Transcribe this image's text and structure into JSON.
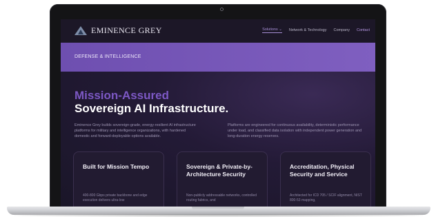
{
  "header": {
    "brand": "EMINENCE GREY",
    "nav": [
      "Solutions ⌄",
      "Network & Technology",
      "Company",
      "Contact"
    ]
  },
  "banner": {
    "label": "DEFENSE & INTELLIGENCE"
  },
  "hero": {
    "line1": "Mission-Assured",
    "line2": "Sovereign AI Infrastructure."
  },
  "intro": {
    "left": "Eminence Grey builds sovereign-grade, energy-resilient AI infrastructure platforms for military and intelligence organizations, with hardened domestic and forward-deployable options available.",
    "right": "Platforms are engineered for continuous availability, deterministic performance under load, and classified data isolation with independent power generation and long-duration energy reserves."
  },
  "cards": [
    {
      "title": "Built for Mission Tempo",
      "body": "400-800 Gbps private backbone and edge execution delivers ultra-low"
    },
    {
      "title": "Sovereign & Private-by-Architecture Security",
      "body": "Non-publicly addressable networks, controlled routing fabrics, and"
    },
    {
      "title": "Accreditation, Physical Security and Service",
      "body": "Architected for ICD 705 / SCIF alignment, NIST 800-53 mapping,"
    }
  ],
  "colors": {
    "accent": "#7c58c4",
    "banner": "#7a58b8",
    "background": "#1a1628"
  }
}
